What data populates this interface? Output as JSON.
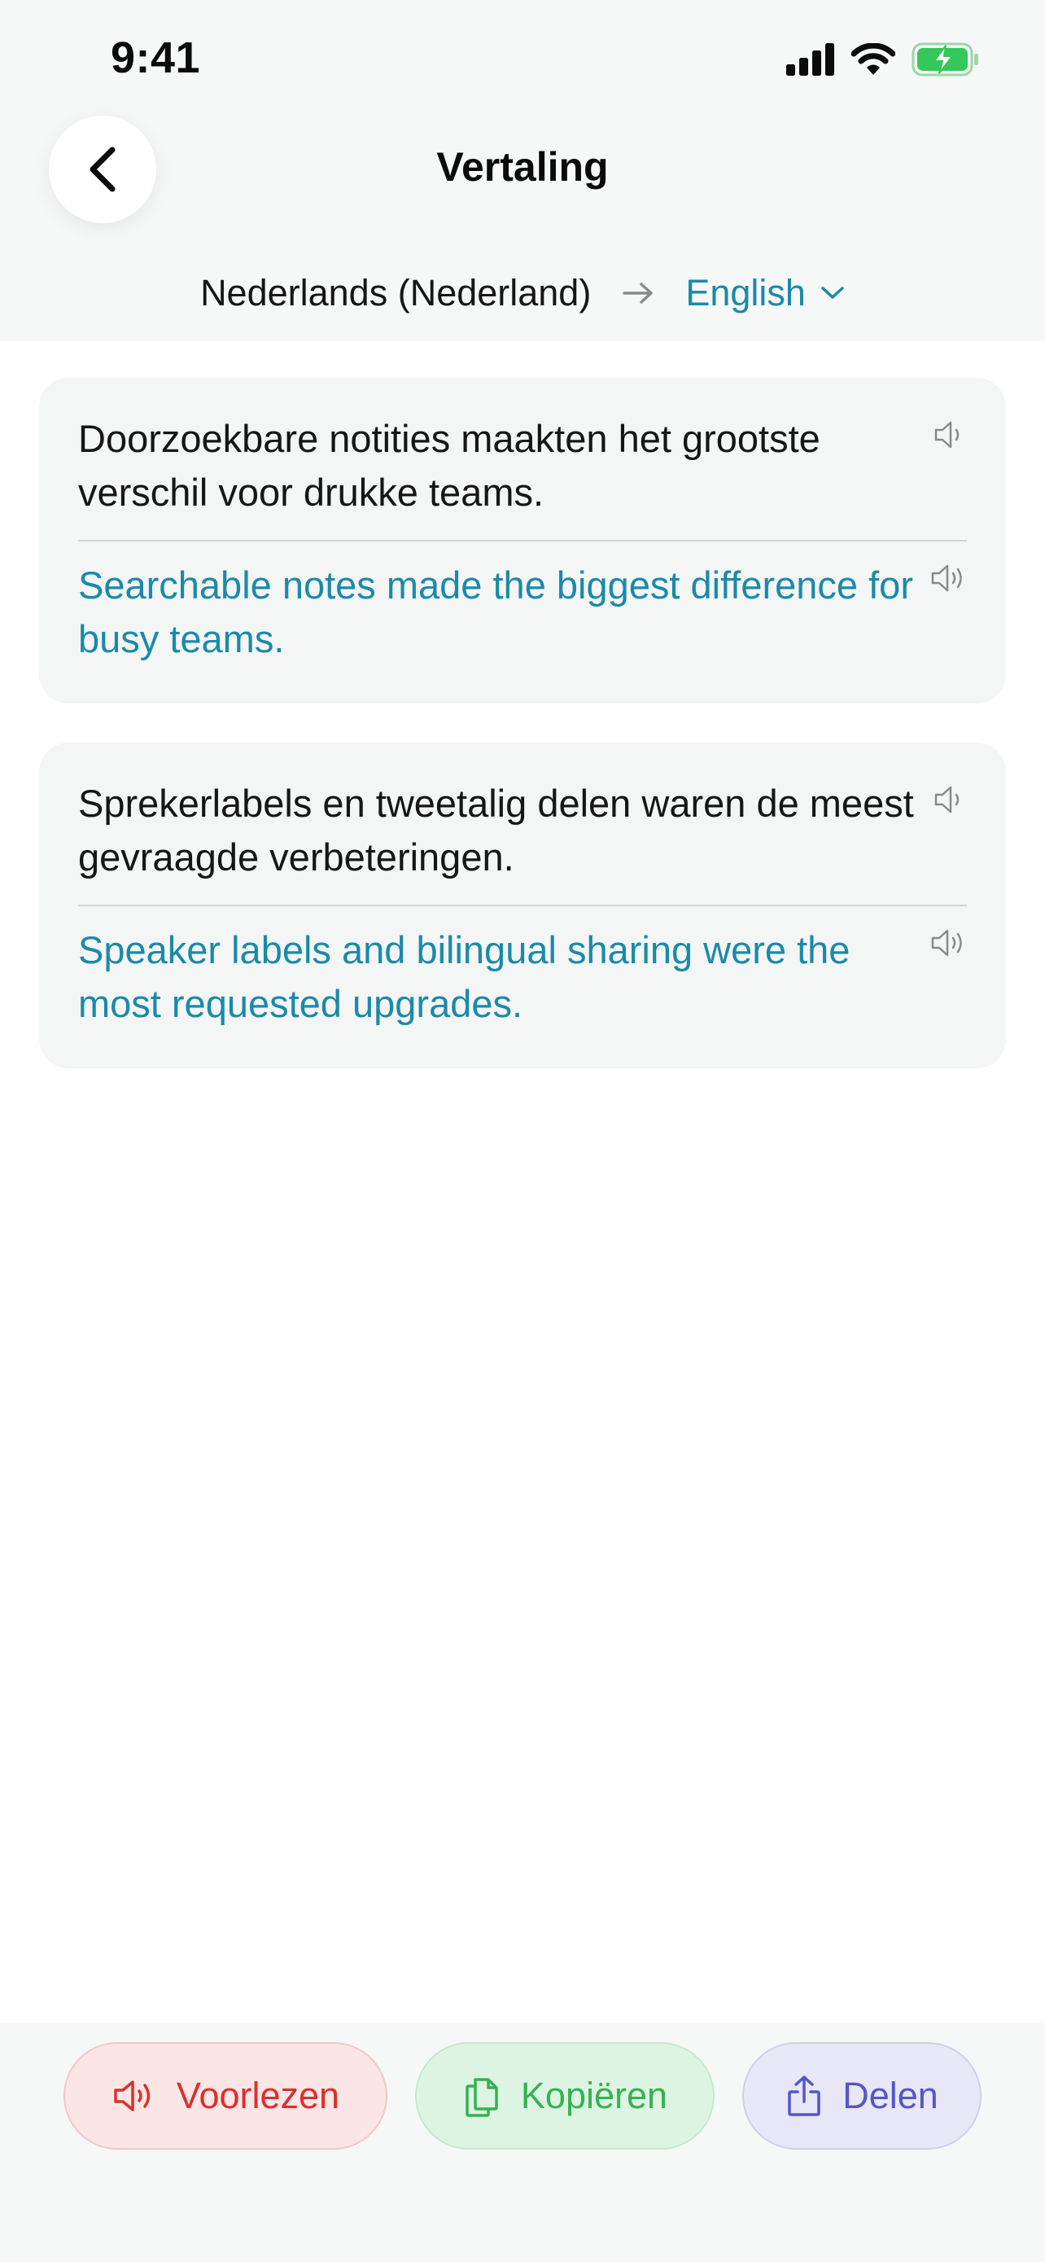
{
  "status_bar": {
    "time": "9:41"
  },
  "header": {
    "title": "Vertaling",
    "source_language": "Nederlands (Nederland)",
    "target_language": "English"
  },
  "entries": [
    {
      "source": "Doorzoekbare notities maakten het grootste verschil voor drukke teams.",
      "translation": "Searchable notes made the biggest difference for busy teams."
    },
    {
      "source": "Sprekerlabels en tweetalig delen waren de meest gevraagde verbeteringen.",
      "translation": "Speaker labels and bilingual sharing were the most requested upgrades."
    }
  ],
  "toolbar": {
    "read_aloud_label": "Voorlezen",
    "copy_label": "Kopiëren",
    "share_label": "Delen"
  },
  "colors": {
    "accent": "#1a8aa8",
    "read_aloud": "#db2f2f",
    "copy": "#34b353",
    "share": "#5556c8",
    "battery": "#34c759"
  },
  "icons": [
    "back-chevron-icon",
    "signal-icon",
    "wifi-icon",
    "battery-charging-icon",
    "arrow-right-icon",
    "chevron-down-icon",
    "speaker-icon",
    "copy-icon",
    "share-icon"
  ]
}
